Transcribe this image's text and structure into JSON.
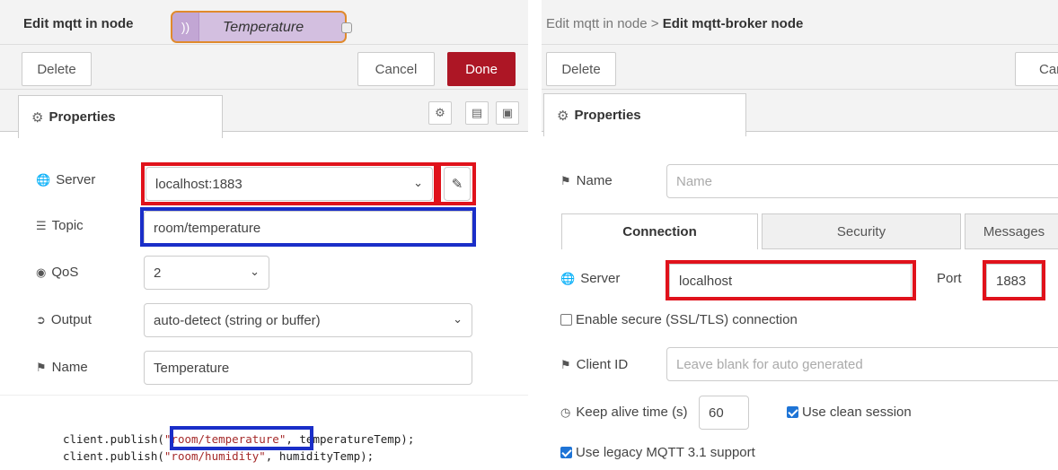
{
  "left": {
    "title": "Edit mqtt in node",
    "node_label": "Temperature",
    "delete_label": "Delete",
    "cancel_label": "Cancel",
    "done_label": "Done",
    "tab_properties": "Properties",
    "server_label": "Server",
    "server_value": "localhost:1883",
    "topic_label": "Topic",
    "topic_value": "room/temperature",
    "qos_label": "QoS",
    "qos_value": "2",
    "output_label": "Output",
    "output_value": "auto-detect (string or buffer)",
    "name_label": "Name",
    "name_value": "Temperature"
  },
  "code": {
    "line1_prefix": "client.publish(",
    "line1_topic": "\"room/temperature\"",
    "line1_suffix": ", temperatureTemp);",
    "line2_prefix": "client.publish(",
    "line2_topic": "\"room/humidity\"",
    "line2_suffix": ", humidityTemp);"
  },
  "right": {
    "crumb_parent": "Edit mqtt in node",
    "crumb_sep": ">",
    "crumb_current": "Edit mqtt-broker node",
    "delete_label": "Delete",
    "cancel_label": "Can",
    "tab_properties": "Properties",
    "name_label": "Name",
    "name_placeholder": "Name",
    "subtabs": [
      "Connection",
      "Security",
      "Messages"
    ],
    "server_label": "Server",
    "server_value": "localhost",
    "port_label": "Port",
    "port_value": "1883",
    "ssl_label": "Enable secure (SSL/TLS) connection",
    "client_id_label": "Client ID",
    "client_id_placeholder": "Leave blank for auto generated",
    "keepalive_label": "Keep alive time (s)",
    "keepalive_value": "60",
    "clean_session_label": "Use clean session",
    "legacy_label": "Use legacy MQTT 3.1 support"
  },
  "colors": {
    "done_button": "#ad1625",
    "highlight_red": "#e0121b",
    "highlight_blue": "#1a2ec8",
    "node_fill": "#d3bfe0",
    "node_border": "#e08a2c",
    "checkbox_checked": "#1e74d6"
  }
}
